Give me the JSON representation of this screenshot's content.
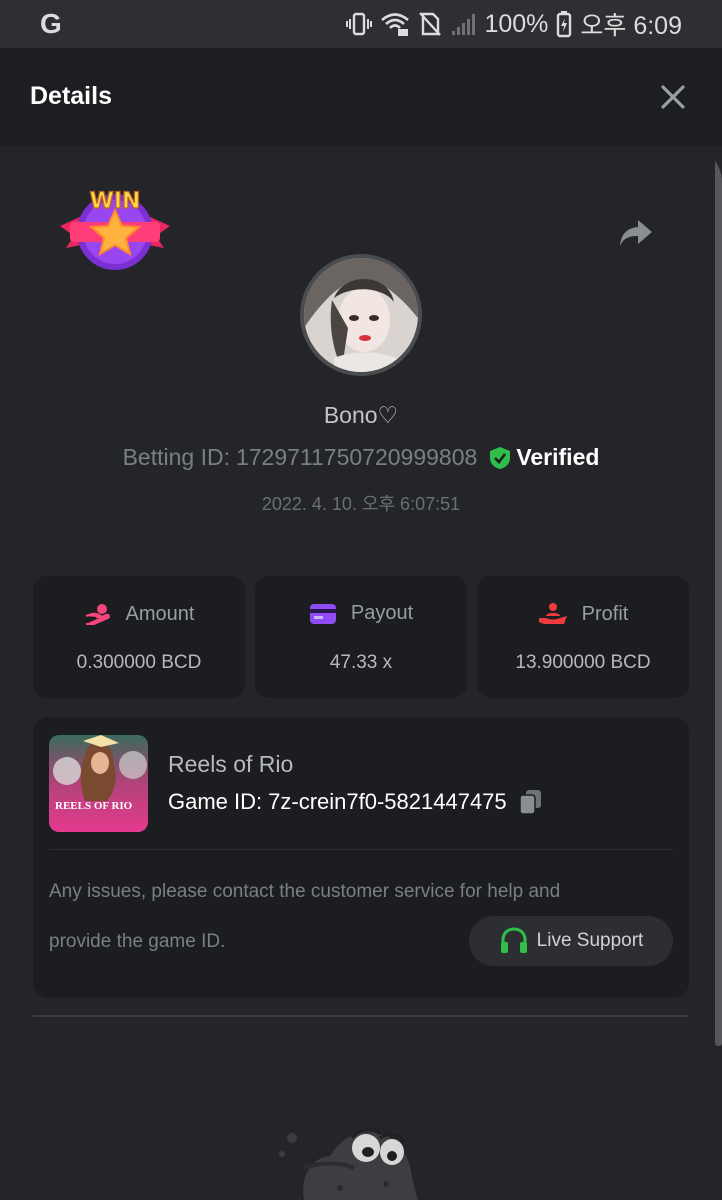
{
  "status_bar": {
    "app_letter": "G",
    "battery": "100%",
    "time": "오후 6:09"
  },
  "header": {
    "title": "Details"
  },
  "win_badge": {
    "text": "WIN"
  },
  "user": {
    "name": "Bono♡",
    "betting_label": "Betting ID:",
    "betting_id": "1729711750720999808",
    "verified": "Verified",
    "timestamp": "2022. 4. 10. 오후 6:07:51"
  },
  "stats": [
    {
      "label": "Amount",
      "value": "0.300000 BCD",
      "icon": "hand-coin-icon",
      "color": "#f5457a"
    },
    {
      "label": "Payout",
      "value": "47.33 x",
      "icon": "card-icon",
      "color": "#8f4cf5"
    },
    {
      "label": "Profit",
      "value": "13.900000 BCD",
      "icon": "hand-person-icon",
      "color": "#ef3b3b"
    }
  ],
  "game": {
    "title": "Reels of Rio",
    "thumb_text": "REELS OF RIO",
    "id_label": "Game ID:",
    "id": "7z-crein7f0-5821447475",
    "help_line1": "Any issues, please contact the customer service for help and",
    "help_line2": "provide the game ID.",
    "support_label": "Live Support"
  },
  "colors": {
    "background": "#232529",
    "card": "#1b1d20",
    "verified": "#2fbf4a",
    "support_icon": "#2fbf4a"
  }
}
